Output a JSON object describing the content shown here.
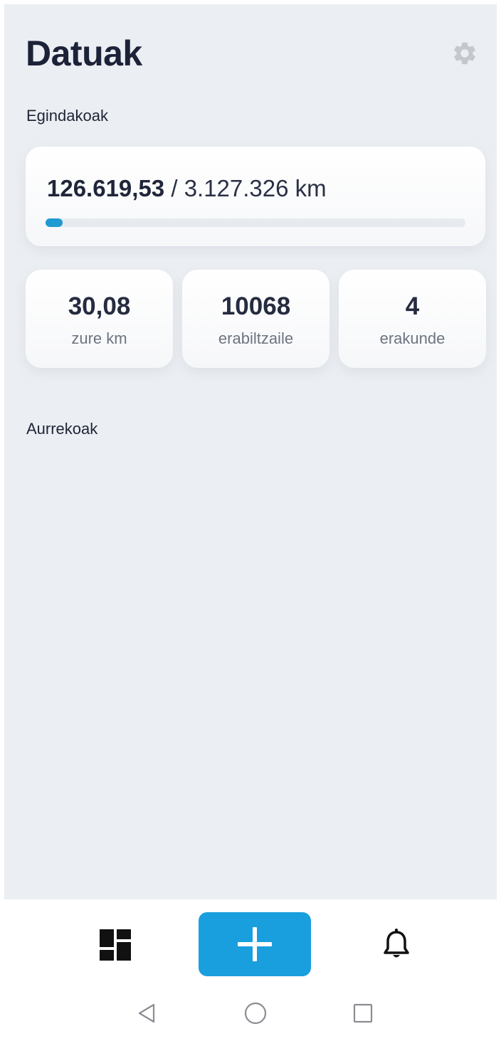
{
  "header": {
    "title": "Datuak",
    "settings_icon": "gear-icon"
  },
  "sections": {
    "done_label": "Egindakoak",
    "previous_label": "Aurrekoak"
  },
  "total": {
    "done": "126.619,53",
    "separator": " / ",
    "goal": "3.127.326 km",
    "progress_fraction": 0.0405
  },
  "stats": [
    {
      "value": "30,08",
      "label": "zure km"
    },
    {
      "value": "10068",
      "label": "erabiltzaile"
    },
    {
      "value": "4",
      "label": "erakunde"
    }
  ],
  "colors": {
    "accent": "#1a9fde",
    "background": "#ebeef2",
    "title": "#1c2238"
  },
  "nav": {
    "left_icon": "dashboard-grid-icon",
    "center_icon": "plus-icon",
    "right_icon": "bell-icon"
  },
  "system_nav": {
    "back_icon": "back-triangle-icon",
    "home_icon": "home-circle-icon",
    "recent_icon": "recents-square-icon"
  }
}
